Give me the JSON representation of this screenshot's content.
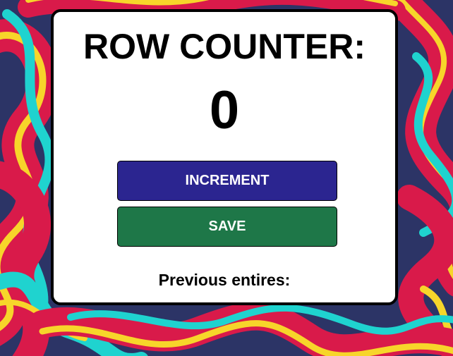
{
  "app": {
    "title": "ROW COUNTER:",
    "count": "0",
    "buttons": {
      "increment_label": "INCREMENT",
      "save_label": "SAVE"
    },
    "previous_entries_label": "Previous entires:"
  },
  "colors": {
    "increment_button": "#2b2590",
    "save_button": "#1e7748",
    "card_background": "#ffffff",
    "card_border": "#000000",
    "background_navy": "#2c3466",
    "background_red": "#d91a4a",
    "background_teal": "#1fd3cf",
    "background_yellow": "#f7d52a"
  }
}
